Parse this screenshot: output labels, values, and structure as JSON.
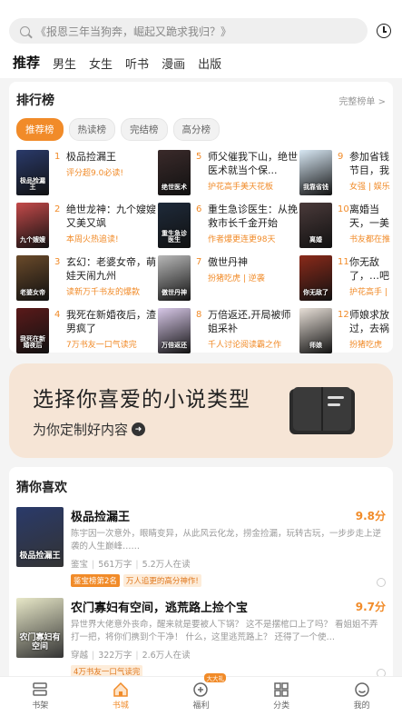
{
  "search": {
    "placeholder": "《报恩三年当狗奔，崛起又跪求我归？》"
  },
  "top_tabs": [
    {
      "label": "推荐",
      "active": true
    },
    {
      "label": "男生"
    },
    {
      "label": "女生"
    },
    {
      "label": "听书"
    },
    {
      "label": "漫画"
    },
    {
      "label": "出版"
    }
  ],
  "ranking": {
    "title": "排行榜",
    "more": "完整榜单 >",
    "tabs": [
      "推荐榜",
      "热读榜",
      "完结榜",
      "高分榜"
    ],
    "items": [
      {
        "num": "1",
        "name": "极品捡漏王",
        "tag": "评分超9.0必读!",
        "cover_text": "极品捡漏王",
        "cover_color": "#2a3a6a"
      },
      {
        "num": "5",
        "name": "师父催我下山，绝世医术就当个保...",
        "tag": "护花高手美天花板",
        "cover_text": "绝世医术",
        "cover_color": "#3a2a2a"
      },
      {
        "num": "9",
        "name": "参加省钱节目，我带…",
        "tag": "女强 | 娱乐",
        "cover_text": "我靠省钱",
        "cover_color": "#d8e8f4"
      },
      {
        "num": "2",
        "name": "绝世龙神：九个嫂嫂又美又飒",
        "tag": "本周火热追读!",
        "cover_text": "九个嫂嫂",
        "cover_color": "#c44a4a"
      },
      {
        "num": "6",
        "name": "重生急诊医生：从挽救市长千金开始",
        "tag": "作者爆更连更98天",
        "cover_text": "重生急诊医生",
        "cover_color": "#1e2a3a"
      },
      {
        "num": "10",
        "name": "离婚当天，一美女求…",
        "tag": "书友都在推荐",
        "cover_text": "离婚",
        "cover_color": "#4a3a3a"
      },
      {
        "num": "3",
        "name": "玄幻：老婆女帝，萌娃天闹九州",
        "tag": "读新万千书友的爆款",
        "cover_text": "老婆女帝",
        "cover_color": "#6a4a2a"
      },
      {
        "num": "7",
        "name": "傲世丹神",
        "tag": "扮猪吃虎 | 逆袭",
        "cover_text": "傲世丹神",
        "cover_color": "#b8b8b8"
      },
      {
        "num": "11",
        "name": "你无敌了，…吧",
        "tag": "护花高手 | 都…",
        "cover_text": "你无敌了",
        "cover_color": "#8a2a1a"
      },
      {
        "num": "4",
        "name": "我死在新婚夜后，渣男疯了",
        "tag": "7万书友一口气读完",
        "cover_text": "我死在新婚夜后",
        "cover_color": "#5a1a1a"
      },
      {
        "num": "8",
        "name": "万倍返还,开局被师姐采补",
        "tag": "千人讨论阅读霸之作",
        "cover_text": "万倍返还",
        "cover_color": "#d8c8e8"
      },
      {
        "num": "12",
        "name": "师娘求放过，去祸害你…",
        "tag": "扮猪吃虎",
        "cover_text": "师娘",
        "cover_color": "#e8e0d8"
      }
    ]
  },
  "banner": {
    "title": "选择你喜爱的小说类型",
    "subtitle": "为你定制好内容"
  },
  "guess": {
    "title": "猜你喜欢",
    "items": [
      {
        "title": "极品捡漏王",
        "score": "9.8分",
        "desc": "陈宇因一次意外，眼睛变异，从此风云化龙，捞金捡漏，玩转古玩，一步步走上逆袭的人生巅峰……",
        "meta": [
          "鉴宝",
          "561万字",
          "5.2万人在读"
        ],
        "badges": [
          {
            "text": "鉴宝榜第2名",
            "style": "dark"
          },
          {
            "text": "万人追更的高分神作!",
            "style": "light"
          }
        ],
        "cover_text": "极品捡漏王",
        "cover_color": "#2a3a6a"
      },
      {
        "title": "农门寡妇有空间，逃荒路上捡个宝",
        "score": "9.7分",
        "desc": "异世界大佬意外丧命，醒来就是要被人下锅？ 这不是摆棺口上了吗？ 看姐姐不弄打一把，将你们携到个干净！ 什么，这里逃荒路上？ 还得了一个使…",
        "meta": [
          "穿越",
          "322万字",
          "2.6万人在读"
        ],
        "badges": [
          {
            "text": "4万书友一口气读完",
            "style": "light"
          }
        ],
        "cover_text": "农门寡妇有空间",
        "cover_color": "#e8e8c8"
      }
    ]
  },
  "bottom_nav": [
    {
      "label": "书架",
      "icon": "bookshelf-icon"
    },
    {
      "label": "书城",
      "icon": "home-icon",
      "active": true
    },
    {
      "label": "福利",
      "icon": "gift-icon",
      "badge": "大大礼"
    },
    {
      "label": "分类",
      "icon": "grid-icon"
    },
    {
      "label": "我的",
      "icon": "profile-icon"
    }
  ],
  "colors": {
    "accent": "#f18b29",
    "banner_bg": "#f6e5d6"
  }
}
